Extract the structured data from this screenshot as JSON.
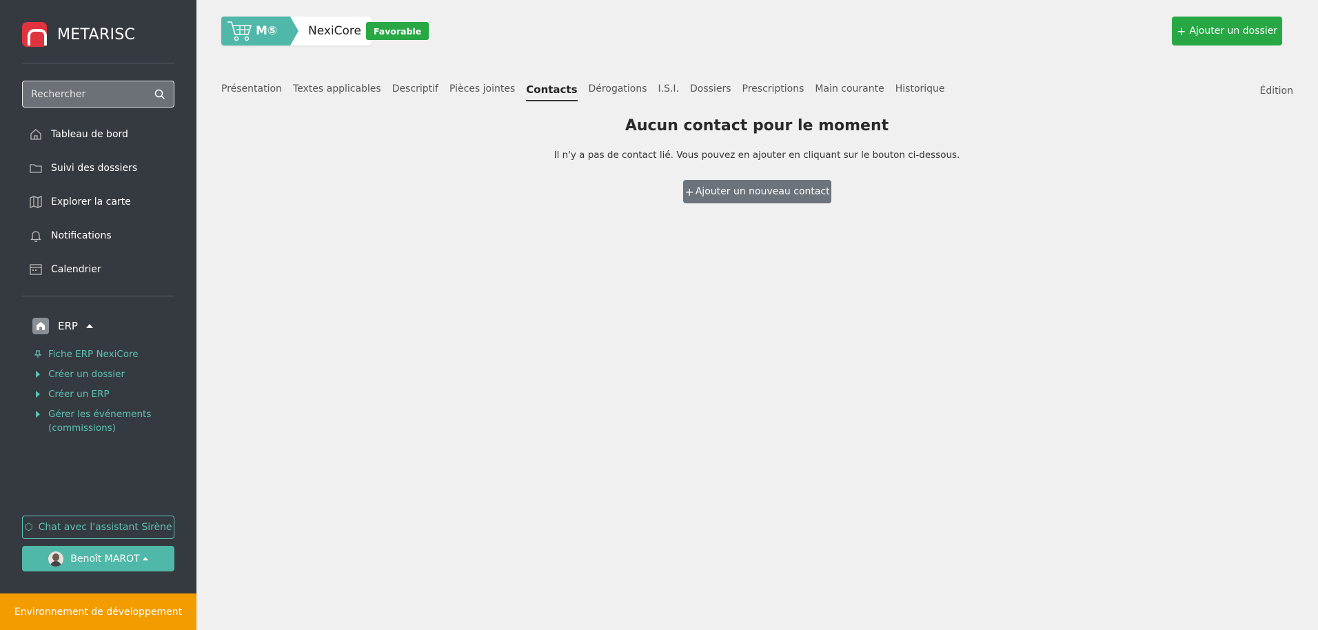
{
  "brand": {
    "name": "METARISC"
  },
  "search": {
    "placeholder": "Rechercher"
  },
  "nav": {
    "items": [
      {
        "label": "Tableau de bord",
        "icon": "home-icon"
      },
      {
        "label": "Suivi des dossiers",
        "icon": "folder-icon"
      },
      {
        "label": "Explorer la carte",
        "icon": "map-icon"
      },
      {
        "label": "Notifications",
        "icon": "bell-icon"
      },
      {
        "label": "Calendrier",
        "icon": "calendar-icon"
      }
    ]
  },
  "erp": {
    "label": "ERP",
    "items": [
      {
        "label": "Fiche ERP NexiCore",
        "icon": "pin-icon"
      },
      {
        "label": "Créer un dossier",
        "icon": "triangle-right-icon"
      },
      {
        "label": "Créer un ERP",
        "icon": "triangle-right-icon"
      },
      {
        "label": "Gérer les événements (commissions)",
        "icon": "triangle-right-icon"
      }
    ]
  },
  "chat": {
    "label": "Chat avec l'assistant Sirène"
  },
  "user": {
    "name": "Benoît MAROT"
  },
  "env": {
    "label": "Environnement de développement"
  },
  "entity": {
    "category": "M⑤",
    "name": "NexiCore"
  },
  "badge": {
    "label": "Favorable"
  },
  "header": {
    "add_dossier": "Ajouter un dossier"
  },
  "tabs": [
    {
      "label": "Présentation"
    },
    {
      "label": "Textes applicables"
    },
    {
      "label": "Descriptif"
    },
    {
      "label": "Pièces jointes"
    },
    {
      "label": "Contacts",
      "active": true
    },
    {
      "label": "Dérogations"
    },
    {
      "label": "I.S.I."
    },
    {
      "label": "Dossiers"
    },
    {
      "label": "Prescriptions"
    },
    {
      "label": "Main courante"
    },
    {
      "label": "Historique"
    }
  ],
  "edit": {
    "label": "Édition"
  },
  "empty": {
    "title": "Aucun contact pour le moment",
    "text": "Il n'y a pas de contact lié. Vous pouvez en ajouter en cliquant sur le bouton ci-dessous.",
    "button": "Ajouter un nouveau contact"
  },
  "colors": {
    "accent": "#4fb8a8",
    "success": "#28a745",
    "sidebar": "#353a40",
    "env": "#f29c00",
    "brand": "#e0323f"
  }
}
